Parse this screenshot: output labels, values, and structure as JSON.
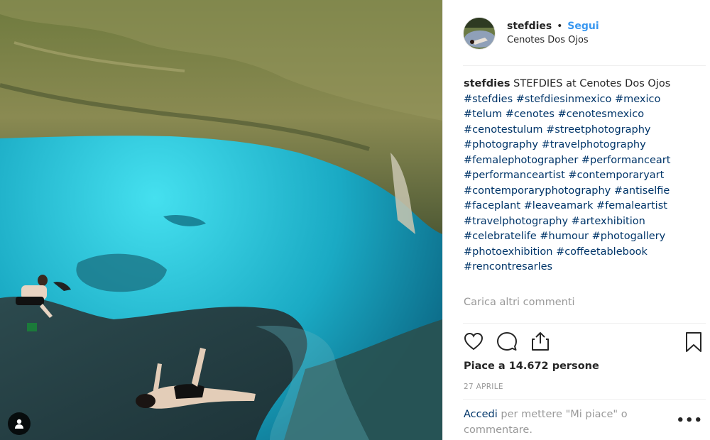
{
  "post": {
    "username": "stefdies",
    "separator": "•",
    "follow_label": "Segui",
    "location": "Cenotes Dos Ojos"
  },
  "caption": {
    "username": "stefdies",
    "text": "STEFDIES at Cenotes Dos Ojos",
    "hashtags": [
      "#stefdies",
      "#stefdiesinmexico",
      "#mexico",
      "#telum",
      "#cenotes",
      "#cenotesmexico",
      "#cenotestulum",
      "#streetphotography",
      "#photography",
      "#travelphotography",
      "#femalephotographer",
      "#performanceart",
      "#performanceartist",
      "#contemporaryart",
      "#contemporaryphotography",
      "#antiselfie",
      "#faceplant",
      "#leaveamark",
      "#femaleartist",
      "#travelphotography",
      "#artexhibition",
      "#celebratelife",
      "#humour",
      "#photogallery",
      "#photoexhibition",
      "#coffeetablebook",
      "#rencontresarles"
    ]
  },
  "load_more_label": "Carica altri commenti",
  "actions": {
    "like_icon": "heart-icon",
    "comment_icon": "comment-icon",
    "share_icon": "share-icon",
    "save_icon": "bookmark-icon"
  },
  "likes_text": "Piace a 14.672 persone",
  "date_text": "27 APRILE",
  "login": {
    "link_label": "Accedi",
    "rest_text": " per mettere \"Mi piace\" o commentare."
  },
  "more_label": "•••",
  "colors": {
    "link": "#003569",
    "follow": "#3897f0",
    "muted": "#999999",
    "water": "#2fc3d6"
  }
}
